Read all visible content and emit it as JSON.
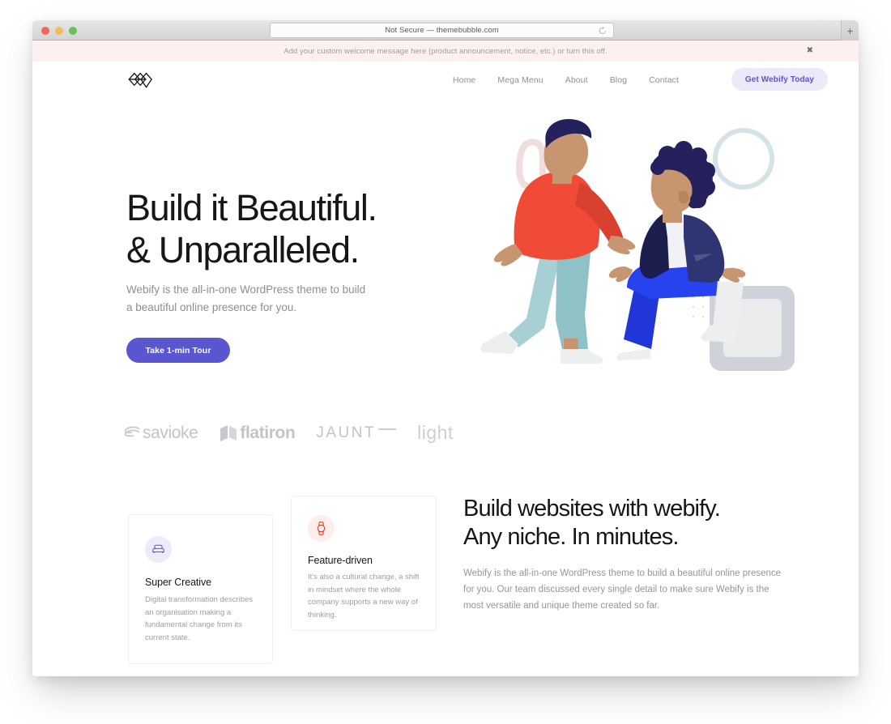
{
  "browser": {
    "url_text": "Not Secure — themebubble.com",
    "reload_icon": "reload-icon",
    "new_tab_label": "+",
    "traffic_lights": [
      "close",
      "minimize",
      "zoom"
    ]
  },
  "notice": {
    "message": "Add your custom welcome message here (product announcement, notice, etc.) or turn this off.",
    "close_label": "✖",
    "background": "#fdf1ef"
  },
  "header": {
    "logo_name": "webify-logo",
    "nav": [
      {
        "label": "Home"
      },
      {
        "label": "Mega Menu"
      },
      {
        "label": "About"
      },
      {
        "label": "Blog"
      },
      {
        "label": "Contact"
      }
    ],
    "cta": {
      "label": "Get Webify Today",
      "background": "#eceaf9",
      "color": "#5b55c9"
    }
  },
  "hero": {
    "heading_line1": "Build it Beautiful.",
    "heading_line2": "& Unparalleled.",
    "subtitle_line1": "Webify is the all-in-one WordPress theme to build",
    "subtitle_line2": "a beautiful online presence for you.",
    "button_label": "Take 1-min Tour",
    "button_color": "#5a56cf",
    "clients": [
      {
        "name": "savioke",
        "style": "logo-mark"
      },
      {
        "name": "flatiron",
        "style": "logo-mark"
      },
      {
        "name": "JAUNT",
        "style": "wordmark"
      },
      {
        "name": "light",
        "style": "wordmark"
      }
    ],
    "illustration": "two-people-walking-and-sitting-illustration"
  },
  "features": {
    "cards": [
      {
        "icon": "sofa-icon",
        "icon_color": "#5a56cf",
        "title": "Super Creative",
        "body": "Digital transformation describes an organisation making a fundamental change from its current state."
      },
      {
        "icon": "watch-icon",
        "icon_color": "#d8402f",
        "title": "Feature-driven",
        "body": "It's also a cultural change, a shift in mindset where the whole company supports a new way of thinking."
      }
    ],
    "right_block": {
      "heading_line1": "Build websites with webify.",
      "heading_line2": "Any niche. In minutes.",
      "paragraph": "Webify is the all-in-one WordPress theme to build a beautiful online presence for you. Our team discussed every single detail to make sure Webify is the most versatile and unique theme created so far."
    }
  }
}
